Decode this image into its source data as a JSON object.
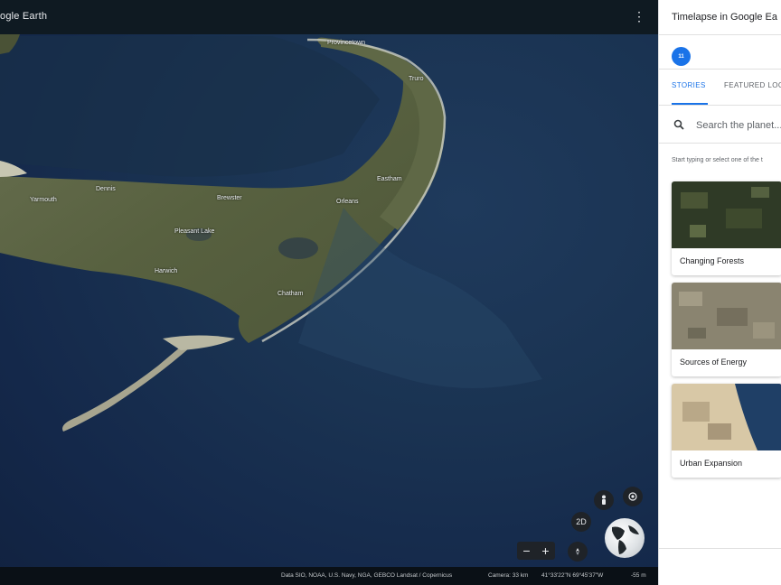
{
  "app": {
    "title": "ogle Earth",
    "menu_icon": "more-vert-icon"
  },
  "map": {
    "labels": {
      "provincetown": "Provincetown",
      "truro": "Truro",
      "yarmouth": "Yarmouth",
      "dennis": "Dennis",
      "brewster": "Brewster",
      "orleans": "Orleans",
      "eastham": "Eastham",
      "pleasant_lake": "Pleasant Lake",
      "harwich": "Harwich",
      "chatham": "Chatham"
    }
  },
  "controls": {
    "mode_2d": "2D",
    "zoom_out": "−",
    "zoom_in": "+"
  },
  "status_bar": {
    "data_credit": "Data SIO, NOAA, U.S. Navy, NGA, GEBCO  Landsat / Copernicus",
    "camera": "Camera: 33 km",
    "coordinates": "41°33'22\"N 69°45'37\"W",
    "altitude": "-55 m"
  },
  "panel": {
    "title": "Timelapse in Google Ea",
    "avatar_text": "11",
    "tabs": [
      {
        "label": "STORIES",
        "active": true
      },
      {
        "label": "FEATURED LOC",
        "active": false
      }
    ],
    "search": {
      "placeholder": "Search the planet..."
    },
    "hint": "Start typing or select one of the t",
    "cards": [
      {
        "label": "Changing Forests"
      },
      {
        "label": "Sources of Energy"
      },
      {
        "label": "Urban Expansion"
      }
    ]
  },
  "colors": {
    "accent": "#1a73e8",
    "ocean": "#1a3352",
    "land": "#5b6440"
  }
}
